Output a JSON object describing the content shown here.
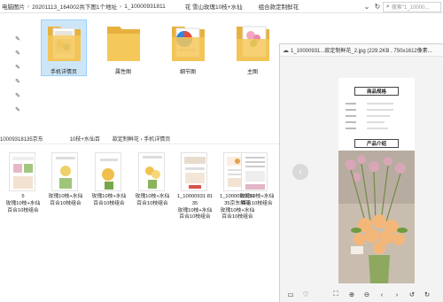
{
  "breadcrumb": {
    "items": [
      "电脑图片",
      "20201113_164002共下图1个地址",
      "1_10000931811",
      "花 雪山玫瑰10枝+水仙",
      "组合款定制鲜花"
    ]
  },
  "search": {
    "placeholder": "搜索\"1_10000..."
  },
  "top_folders": [
    {
      "label": "手机详情页",
      "selected": true
    },
    {
      "label": "属性图",
      "selected": false
    },
    {
      "label": "细节图",
      "selected": false
    },
    {
      "label": "主图",
      "selected": false
    }
  ],
  "breadcrumb2": {
    "text": "10009318135京东",
    "text2": "10枝+水仙百",
    "text3": "款定制鲜花 › 手机详情页"
  },
  "thumbnails": [
    {
      "cap": [
        "",
        "",
        ""
      ]
    },
    {
      "cap": [
        "",
        "",
        ""
      ]
    },
    {
      "cap": [
        "",
        "",
        ""
      ]
    },
    {
      "cap": [
        "",
        "",
        ""
      ]
    },
    {
      "cap": [
        "",
        "",
        ""
      ]
    },
    {
      "cap": [
        "",
        "",
        ""
      ]
    },
    {
      "cap": [
        "",
        "",
        ""
      ]
    }
  ],
  "thumb_captions": [
    [
      "5",
      "玫瑰10枝+水仙",
      "百合10枝组合"
    ],
    [
      "",
      "玫瑰10枝+水仙",
      "百合10枝组合"
    ],
    [
      "",
      "玫瑰10枝+水仙",
      "百合10枝组合"
    ],
    [
      "",
      "玫瑰10枝+水仙",
      "百合10枝组合"
    ],
    [
      "1_10000931 81",
      "35",
      "玫瑰10枝+水仙",
      "百合10枝组合"
    ],
    [
      "1_10000931 81",
      "35京东鲜花",
      "玫瑰10枝+水仙",
      "百合10枝组合"
    ],
    [
      "",
      "玫瑰10枝+水仙",
      "百合10枝组合"
    ]
  ],
  "viewer": {
    "title": "1_10000931...款定制鲜花_2.jpg (229.2KB , 750x1612像素...",
    "doc_header1": "商品规格",
    "doc_header2": "产品介绍",
    "nav_prev": "‹"
  },
  "colors": {
    "folder": "#f5c85a",
    "folder_dark": "#e8b13e",
    "select_bg": "#cde6f7",
    "viewer_bg": "#f3f3f3"
  }
}
